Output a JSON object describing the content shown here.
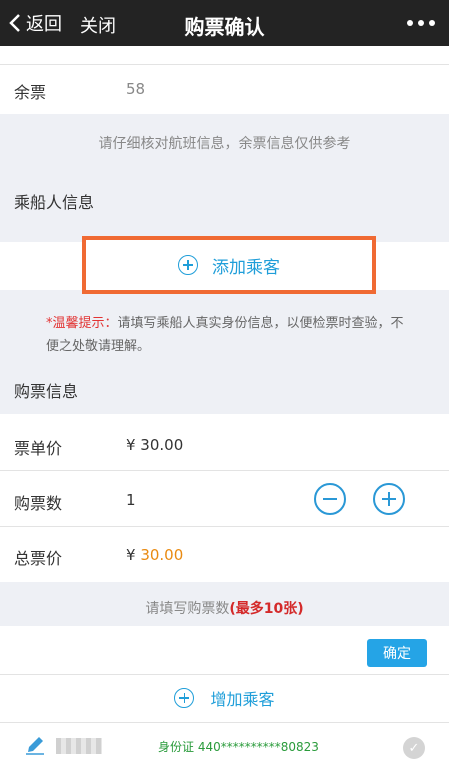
{
  "topbar": {
    "back_label": "返回",
    "close_label": "关闭",
    "title": "购票确认"
  },
  "remaining": {
    "label": "余票",
    "value": "58"
  },
  "notice": "请仔细核对航班信息，余票信息仅供参考",
  "passenger_section": {
    "title": "乘船人信息",
    "add_label": "添加乘客"
  },
  "tip": {
    "label": "*温馨提示：",
    "text": "请填写乘船人真实身份信息，以便检票时查验，不便之处敬请理解。"
  },
  "purchase_section": {
    "title": "购票信息",
    "unit_price_label": "票单价",
    "unit_price_value": "¥ 30.00",
    "quantity_label": "购票数",
    "quantity_value": "1",
    "total_label": "总票价",
    "total_currency": "¥ ",
    "total_value": "30.00"
  },
  "quantity_hint": {
    "text": "请填写购票数",
    "limit": "(最多10张)"
  },
  "confirm_label": "确定",
  "add_passenger_label": "增加乘客",
  "passenger_entry": {
    "id_text": "身份证 440**********80823"
  },
  "colors": {
    "accent": "#1f9ed9",
    "highlight_box": "#f06a33",
    "total_price": "#e98a11",
    "warning": "#e23434"
  }
}
